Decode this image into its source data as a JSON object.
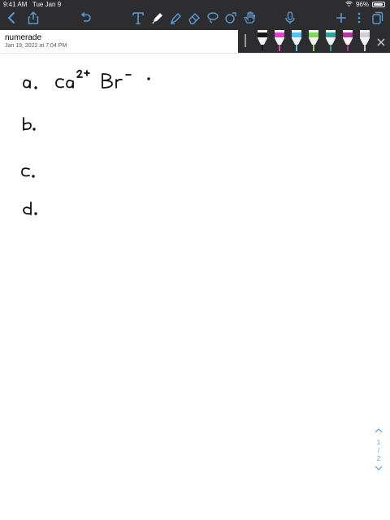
{
  "status_bar": {
    "time": "9:41 AM",
    "date": "Tue Jan 9",
    "battery": "96%"
  },
  "toolbar": {
    "icons": [
      "chevron-left-icon",
      "share-icon",
      "undo-icon",
      "text-tool-icon",
      "pen-icon",
      "highlighter-icon",
      "eraser-icon",
      "lasso-icon",
      "shapes-icon",
      "hand-icon",
      "microphone-icon",
      "plus-icon",
      "more-icon",
      "pages-icon"
    ]
  },
  "document": {
    "title": "numerade",
    "date": "Jan 19, 2022 at 7:04 PM"
  },
  "pen_tray": {
    "pens": [
      {
        "color": "#1a1a1a"
      },
      {
        "color": "#e040c8"
      },
      {
        "color": "#4fc3f7"
      },
      {
        "color": "#7ed957"
      },
      {
        "color": "#26a69a"
      },
      {
        "color": "#b0359e"
      },
      {
        "color": "#cfcfcf"
      }
    ]
  },
  "handwriting": {
    "labels": [
      "a.",
      "b.",
      "c.",
      "d."
    ],
    "answer_a": "Ca²⁺ Br⁻ ·"
  },
  "page_nav": {
    "current": "1",
    "separator": "/",
    "total": "2"
  },
  "colors": {
    "toolbar_bg": "#2d2d2f",
    "accent": "#5b9bd5"
  }
}
